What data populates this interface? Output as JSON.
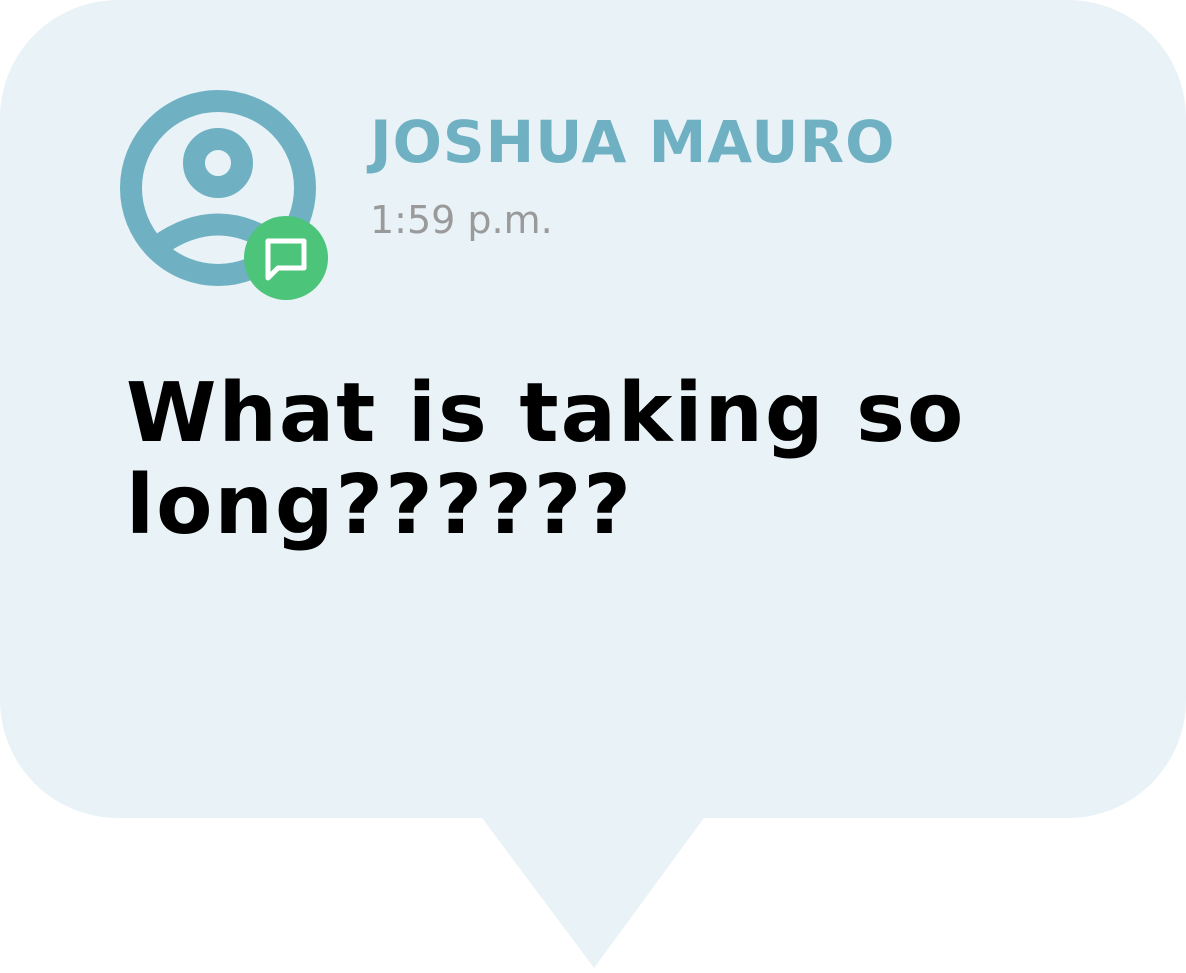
{
  "message": {
    "sender_name": "JOSHUA MAURO",
    "timestamp": "1:59 p.m.",
    "text": "What is taking so long??????"
  },
  "icons": {
    "avatar": "user-avatar-icon",
    "badge": "chat-message-icon"
  },
  "colors": {
    "bubble": "#e9f3f7",
    "accent": "#6fb1c2",
    "badge": "#4cc47a",
    "timestamp": "#9a9a9a",
    "text": "#000000"
  }
}
